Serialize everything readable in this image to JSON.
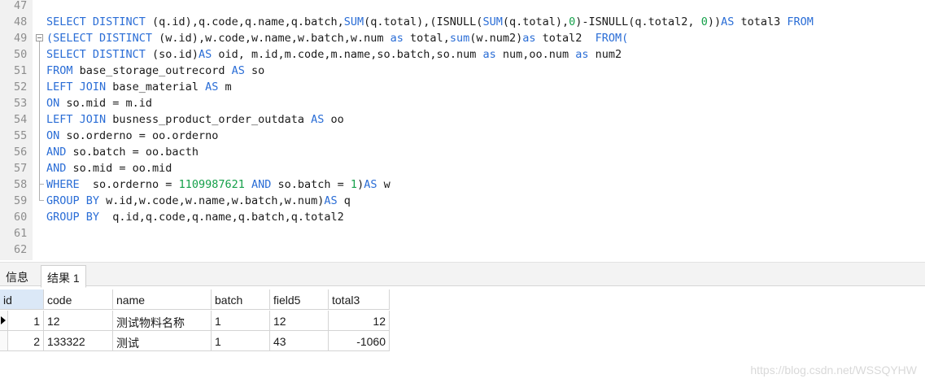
{
  "editor": {
    "lines": [
      {
        "num": "47",
        "tokens": []
      },
      {
        "num": "48",
        "tokens": [
          {
            "t": "SELECT DISTINCT ",
            "c": "k"
          },
          {
            "t": "(q.id),q.code,q.name,q.batch,"
          },
          {
            "t": "SUM",
            "c": "k"
          },
          {
            "t": "(q.total),(ISNULL("
          },
          {
            "t": "SUM",
            "c": "k"
          },
          {
            "t": "(q.total),"
          },
          {
            "t": "0",
            "c": "n"
          },
          {
            "t": ")-ISNULL(q.total2, "
          },
          {
            "t": "0",
            "c": "n"
          },
          {
            "t": "))"
          },
          {
            "t": "AS",
            "c": "k"
          },
          {
            "t": " total3 "
          },
          {
            "t": "FROM",
            "c": "k"
          }
        ]
      },
      {
        "num": "49",
        "tokens": [
          {
            "t": "(SELECT DISTINCT ",
            "c": "k"
          },
          {
            "t": "(w.id),w.code,w.name,w.batch,w.num "
          },
          {
            "t": "as",
            "c": "k"
          },
          {
            "t": " total,"
          },
          {
            "t": "sum",
            "c": "k"
          },
          {
            "t": "(w.num2)"
          },
          {
            "t": "as",
            "c": "k"
          },
          {
            "t": " total2  "
          },
          {
            "t": "FROM(",
            "c": "k"
          }
        ]
      },
      {
        "num": "50",
        "tokens": [
          {
            "t": "SELECT DISTINCT ",
            "c": "k"
          },
          {
            "t": "(so.id)"
          },
          {
            "t": "AS",
            "c": "k"
          },
          {
            "t": " oid, m.id,m.code,m.name,so.batch,so.num "
          },
          {
            "t": "as",
            "c": "k"
          },
          {
            "t": " num,oo.num "
          },
          {
            "t": "as",
            "c": "k"
          },
          {
            "t": " num2"
          }
        ]
      },
      {
        "num": "51",
        "tokens": [
          {
            "t": "FROM",
            "c": "k"
          },
          {
            "t": " base_storage_outrecord "
          },
          {
            "t": "AS",
            "c": "k"
          },
          {
            "t": " so"
          }
        ]
      },
      {
        "num": "52",
        "tokens": [
          {
            "t": "LEFT JOIN",
            "c": "k"
          },
          {
            "t": " base_material "
          },
          {
            "t": "AS",
            "c": "k"
          },
          {
            "t": " m"
          }
        ]
      },
      {
        "num": "53",
        "tokens": [
          {
            "t": "ON",
            "c": "k"
          },
          {
            "t": " so.mid = m.id"
          }
        ]
      },
      {
        "num": "54",
        "tokens": [
          {
            "t": "LEFT JOIN",
            "c": "k"
          },
          {
            "t": " busness_product_order_outdata "
          },
          {
            "t": "AS",
            "c": "k"
          },
          {
            "t": " oo"
          }
        ]
      },
      {
        "num": "55",
        "tokens": [
          {
            "t": "ON",
            "c": "k"
          },
          {
            "t": " so.orderno = oo.orderno"
          }
        ]
      },
      {
        "num": "56",
        "tokens": [
          {
            "t": "AND",
            "c": "k"
          },
          {
            "t": " so.batch = oo.bacth"
          }
        ]
      },
      {
        "num": "57",
        "tokens": [
          {
            "t": "AND",
            "c": "k"
          },
          {
            "t": " so.mid = oo.mid"
          }
        ]
      },
      {
        "num": "58",
        "tokens": [
          {
            "t": "WHERE",
            "c": "k"
          },
          {
            "t": "  so.orderno = "
          },
          {
            "t": "1109987621",
            "c": "n"
          },
          {
            "t": " "
          },
          {
            "t": "AND",
            "c": "k"
          },
          {
            "t": " so.batch = "
          },
          {
            "t": "1",
            "c": "n"
          },
          {
            "t": ")"
          },
          {
            "t": "AS",
            "c": "k"
          },
          {
            "t": " w"
          }
        ]
      },
      {
        "num": "59",
        "tokens": [
          {
            "t": "GROUP BY",
            "c": "k"
          },
          {
            "t": " w.id,w.code,w.name,w.batch,w.num)"
          },
          {
            "t": "AS",
            "c": "k"
          },
          {
            "t": " q"
          }
        ]
      },
      {
        "num": "60",
        "tokens": [
          {
            "t": "GROUP BY",
            "c": "k"
          },
          {
            "t": "  q.id,q.code,q.name,q.batch,q.total2"
          }
        ]
      },
      {
        "num": "61",
        "tokens": []
      },
      {
        "num": "62",
        "tokens": []
      }
    ]
  },
  "tabs": {
    "info": "信息",
    "result": "结果 1"
  },
  "grid": {
    "columns": [
      "id",
      "code",
      "name",
      "batch",
      "field5",
      "total3"
    ],
    "rows": [
      [
        "1",
        "12",
        "测试物料名称",
        "1",
        "12",
        "12"
      ],
      [
        "2",
        "133322",
        "测试",
        "1",
        "43",
        "-1060"
      ]
    ]
  },
  "watermark": "https://blog.csdn.net/WSSQYHW",
  "colors": {
    "keyword": "#2a6dd6",
    "number": "#15a04a",
    "selected_header": "#dbe8f7"
  }
}
